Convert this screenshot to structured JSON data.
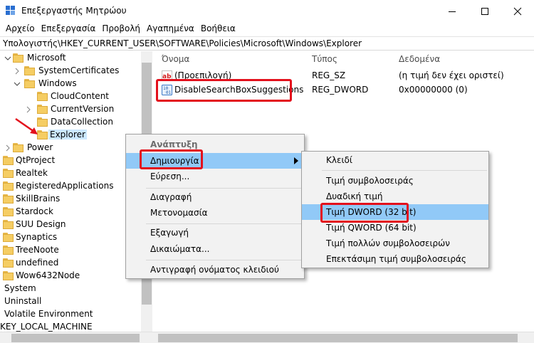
{
  "window": {
    "title": "Επεξεργαστής Μητρώου"
  },
  "menu": [
    "Αρχείο",
    "Επεξεργασία",
    "Προβολή",
    "Αγαπημένα",
    "Βοήθεια"
  ],
  "address": "Υπολογιστής\\HKEY_CURRENT_USER\\SOFTWARE\\Policies\\Microsoft\\Windows\\Explorer",
  "tree": [
    {
      "label": "Microsoft",
      "expanded": true
    },
    {
      "label": "SystemCertificates",
      "expanded": false
    },
    {
      "label": "Windows",
      "expanded": true
    },
    {
      "label": "CloudContent",
      "expanded": false
    },
    {
      "label": "CurrentVersion",
      "expanded": false
    },
    {
      "label": "DataCollection",
      "expanded": false
    },
    {
      "label": "Explorer",
      "selected": true
    },
    {
      "label": "Power",
      "expanded": false
    },
    {
      "label": "QtProject",
      "expanded": false
    },
    {
      "label": "Realtek",
      "expanded": false
    },
    {
      "label": "RegisteredApplications",
      "expanded": false
    },
    {
      "label": "SkillBrains",
      "expanded": false
    },
    {
      "label": "Stardock",
      "expanded": false
    },
    {
      "label": "SUU Design",
      "expanded": false
    },
    {
      "label": "Synaptics",
      "expanded": false
    },
    {
      "label": "TreeNoote",
      "expanded": false
    },
    {
      "label": "undefined",
      "expanded": false
    },
    {
      "label": "Wow6432Node",
      "expanded": false
    },
    {
      "label": "System",
      "expanded": false
    },
    {
      "label": "Uninstall",
      "expanded": false
    },
    {
      "label": "Volatile Environment",
      "expanded": false
    },
    {
      "label": "KEY_LOCAL_MACHINE",
      "expanded": false
    }
  ],
  "columns": {
    "name": "Όνομα",
    "type": "Τύπος",
    "data": "Δεδομένα"
  },
  "values": [
    {
      "name": "(Προεπιλογή)",
      "type": "REG_SZ",
      "data": "(η τιμή δεν έχει οριστεί)",
      "icon": "string-value-icon",
      "icon_text": "ab"
    },
    {
      "name": "DisableSearchBoxSuggestions",
      "type": "REG_DWORD",
      "data": "0x00000000 (0)",
      "icon": "dword-value-icon",
      "icon_text": "10"
    }
  ],
  "context_menu": {
    "header": "Ανάπτυξη",
    "new": "Δημιουργία",
    "find": "Εύρεση...",
    "delete": "Διαγραφή",
    "rename": "Μετονομασία",
    "export": "Εξαγωγή",
    "permissions": "Δικαιώματα...",
    "copy_key_name": "Αντιγραφή ονόματος κλειδιού"
  },
  "submenu": {
    "key": "Κλειδί",
    "string": "Τιμή συμβολοσειράς",
    "binary": "Δυαδική τιμή",
    "dword": "Τιμή DWORD (32 bit)",
    "qword": "Τιμή QWORD (64 bit)",
    "multi_string": "Τιμή πολλών συμβολοσειρών",
    "expandable_string": "Επεκτάσιμη τιμή συμβολοσειράς"
  },
  "colors": {
    "highlight_red": "#e3101c",
    "menu_hover": "#91c9f7",
    "selection": "#cce8ff"
  }
}
